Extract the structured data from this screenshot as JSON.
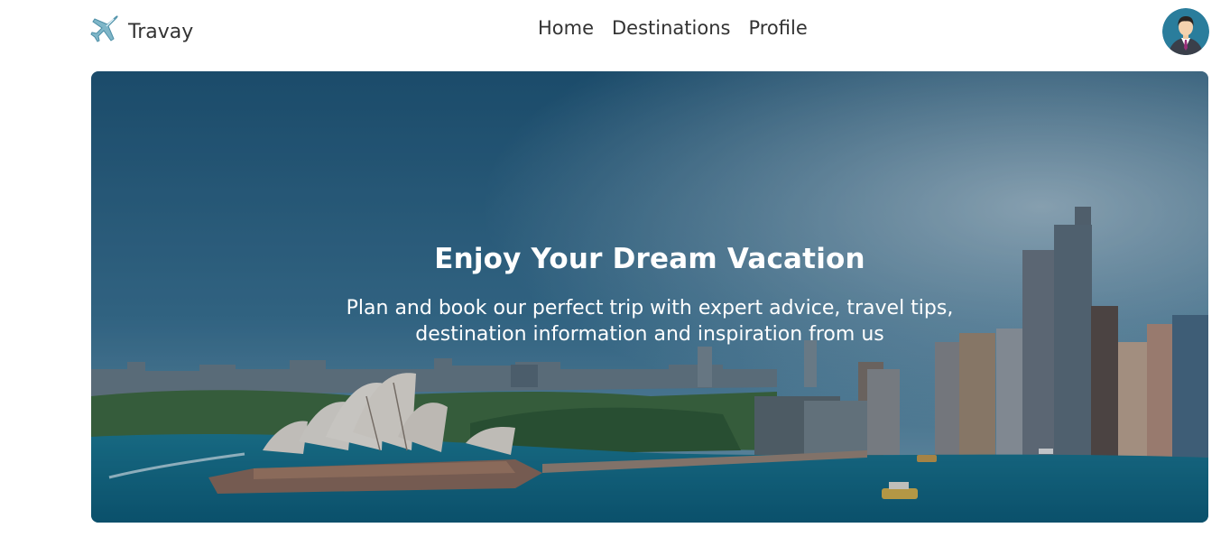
{
  "brand": {
    "name": "Travay",
    "icon": "airplane-icon"
  },
  "nav": {
    "links": [
      "Home",
      "Destinations",
      "Profile"
    ]
  },
  "user": {
    "avatar_icon": "user-avatar-icon"
  },
  "hero": {
    "title": "Enjoy Your Dream Vacation",
    "subtitle": "Plan and book our perfect trip with expert advice, travel tips, destination information and inspiration from us",
    "image": "sydney-harbour-skyline-photo"
  },
  "colors": {
    "text": "#333333",
    "hero_text": "#ffffff",
    "sky": "#2f6a8e",
    "water": "#0f6f8c"
  }
}
